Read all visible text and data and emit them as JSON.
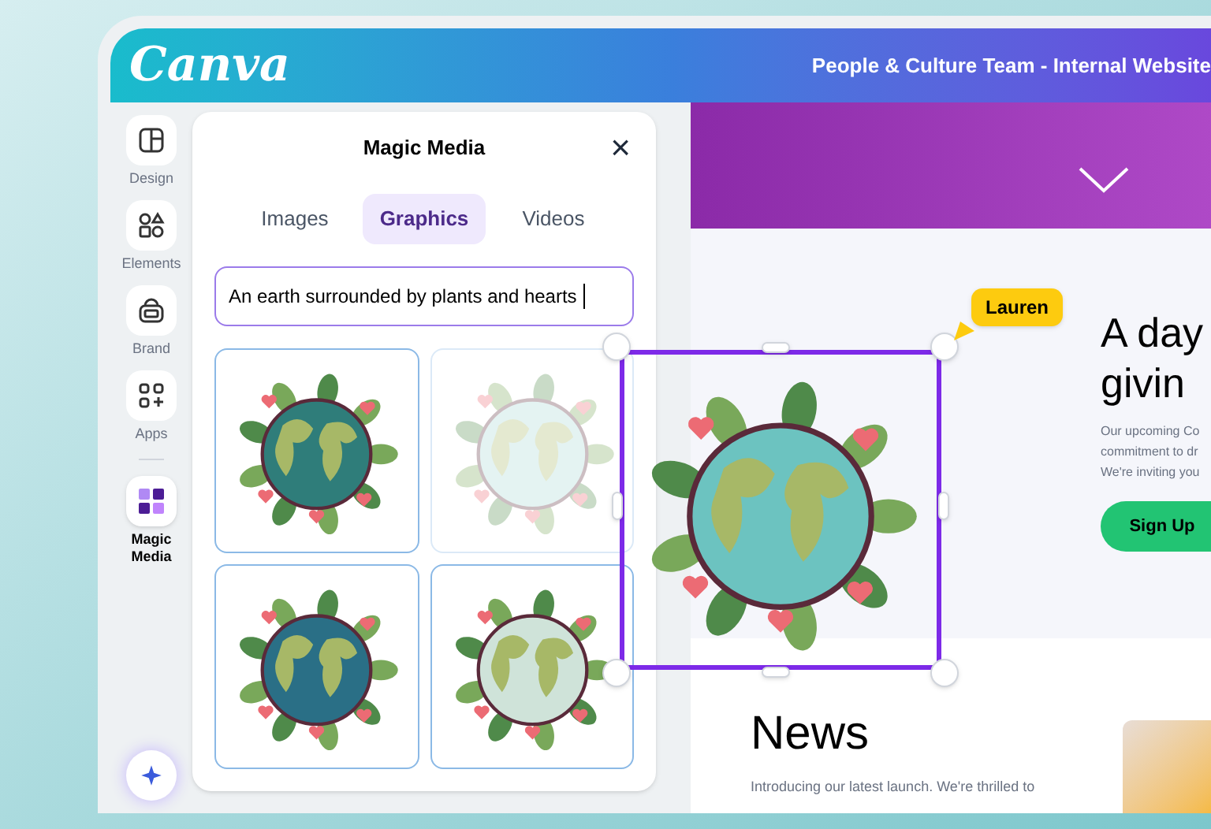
{
  "header": {
    "logo": "Canva",
    "title": "People & Culture Team - Internal Website"
  },
  "sidebar": {
    "items": [
      {
        "label": "Design",
        "kind": "design",
        "selected": false
      },
      {
        "label": "Elements",
        "kind": "elements",
        "selected": false
      },
      {
        "label": "Brand",
        "kind": "brand",
        "selected": false
      },
      {
        "label": "Apps",
        "kind": "apps",
        "selected": false
      },
      {
        "label": "Magic Media",
        "kind": "magic",
        "selected": true
      }
    ]
  },
  "panel": {
    "title": "Magic Media",
    "close": "×",
    "tabs": [
      {
        "label": "Images",
        "selected": false
      },
      {
        "label": "Graphics",
        "selected": true
      },
      {
        "label": "Videos",
        "selected": false
      }
    ],
    "prompt": {
      "value": "An earth surrounded by plants and hearts"
    },
    "results": [
      {
        "dragging": false
      },
      {
        "dragging": true
      },
      {
        "dragging": false
      },
      {
        "dragging": false
      }
    ]
  },
  "canvas": {
    "heading_lines": [
      "A day",
      "givin"
    ],
    "paragraph_lines": [
      "Our upcoming Co",
      "commitment to dr",
      "We're inviting you"
    ],
    "button": "Sign Up",
    "collaborator": {
      "name": "Lauren",
      "color": "#fdcb0f"
    },
    "news": {
      "heading": "News",
      "text": "Introducing our latest launch. We're thrilled to"
    }
  }
}
